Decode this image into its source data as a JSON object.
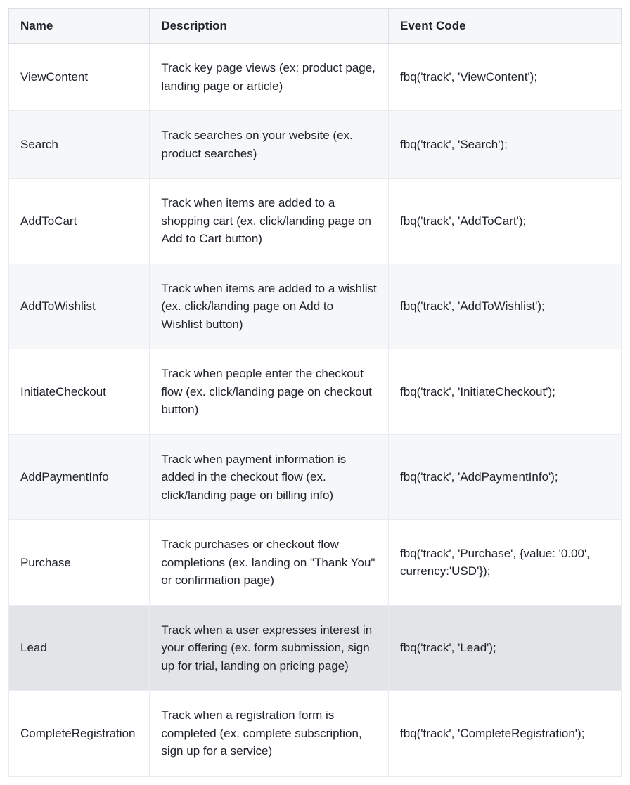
{
  "table": {
    "headers": {
      "name": "Name",
      "description": "Description",
      "event_code": "Event Code"
    },
    "rows": [
      {
        "name": "ViewContent",
        "description": "Track key page views (ex: product page, landing page or article)",
        "event_code": "fbq('track', 'ViewContent');"
      },
      {
        "name": "Search",
        "description": "Track searches on your website (ex. product searches)",
        "event_code": "fbq('track', 'Search');"
      },
      {
        "name": "AddToCart",
        "description": "Track when items are added to a shopping cart (ex. click/landing page on Add to Cart button)",
        "event_code": "fbq('track', 'AddToCart');"
      },
      {
        "name": "AddToWishlist",
        "description": "Track when items are added to a wishlist (ex. click/landing page on Add to Wishlist button)",
        "event_code": "fbq('track', 'AddToWishlist');"
      },
      {
        "name": "InitiateCheckout",
        "description": "Track when people enter the checkout flow (ex. click/landing page on checkout button)",
        "event_code": "fbq('track', 'InitiateCheckout');"
      },
      {
        "name": "AddPaymentInfo",
        "description": "Track when payment information is added in the checkout flow (ex. click/landing page on billing info)",
        "event_code": "fbq('track', 'AddPaymentInfo');"
      },
      {
        "name": "Purchase",
        "description": "Track purchases or checkout flow completions (ex. landing on \"Thank You\" or confirmation page)",
        "event_code": "fbq('track', 'Purchase', {value: '0.00', currency:'USD'});"
      },
      {
        "name": "Lead",
        "description": "Track when a user expresses interest in your offering (ex. form submission, sign up for trial, landing on pricing page)",
        "event_code": "fbq('track', 'Lead');",
        "highlight": true
      },
      {
        "name": "CompleteRegistration",
        "description": "Track when a registration form is completed (ex. complete subscription, sign up for a service)",
        "event_code": "fbq('track', 'CompleteRegistration');"
      }
    ]
  }
}
